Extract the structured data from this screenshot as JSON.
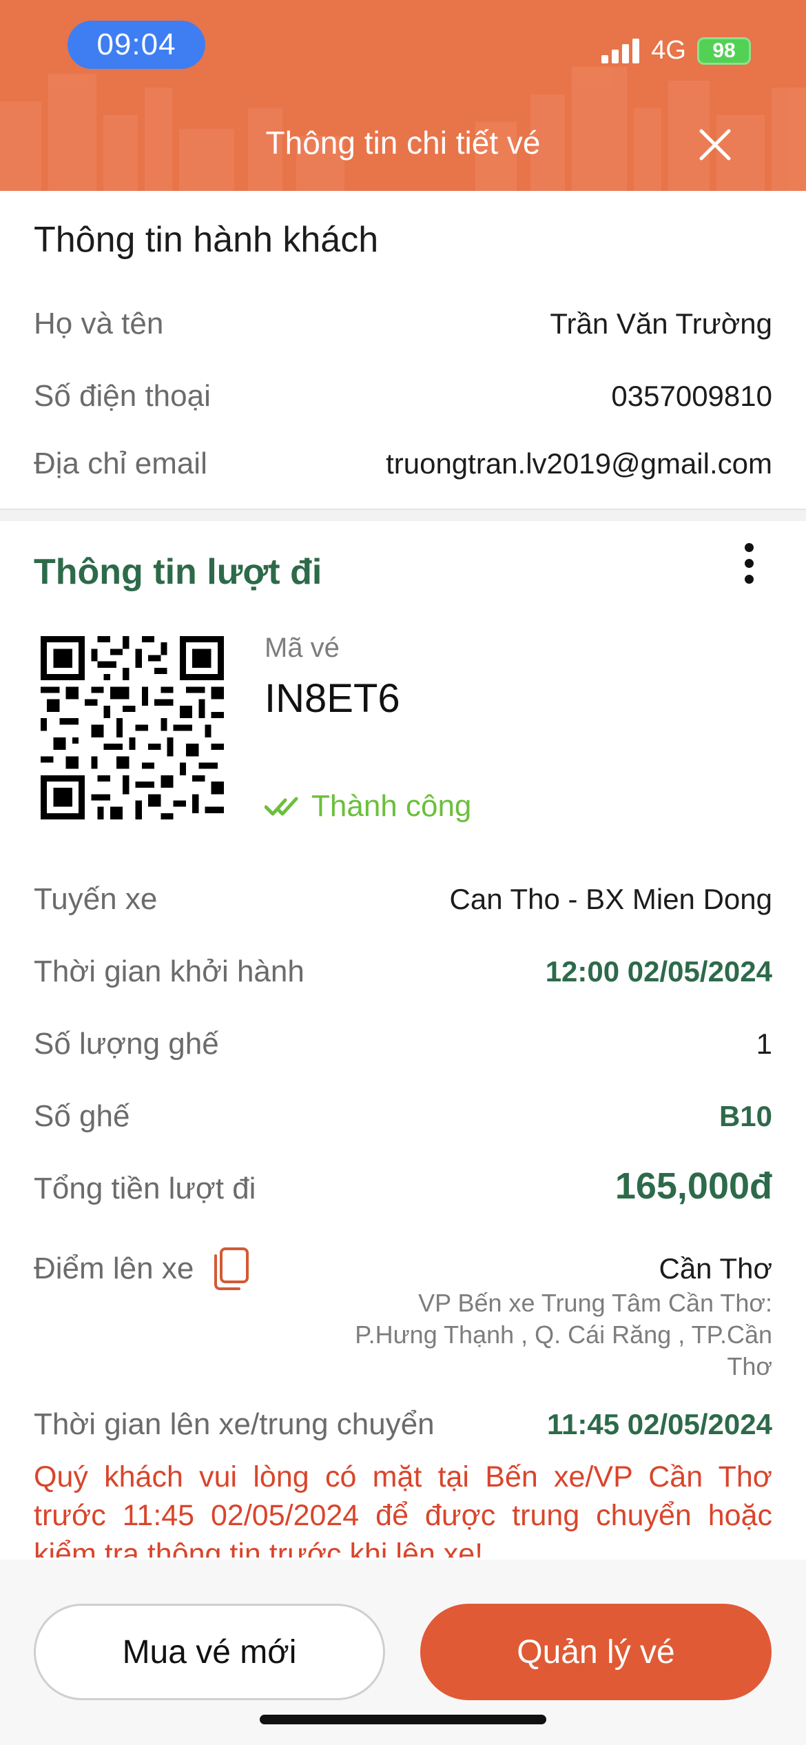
{
  "status_bar": {
    "time": "09:04",
    "network": "4G",
    "battery": "98"
  },
  "header": {
    "title": "Thông tin chi tiết vé"
  },
  "passenger": {
    "title": "Thông tin hành khách",
    "rows": [
      {
        "label": "Họ và tên",
        "value": "Trần Văn Trường"
      },
      {
        "label": "Số điện thoại",
        "value": "0357009810"
      },
      {
        "label": "Địa chỉ email",
        "value": "truongtran.lv2019@gmail.com"
      }
    ]
  },
  "trip": {
    "title": "Thông tin lượt đi",
    "code_label": "Mã vé",
    "code": "IN8ET6",
    "status": "Thành công",
    "route": {
      "label": "Tuyến xe",
      "value": "Can Tho - BX Mien Dong"
    },
    "departure": {
      "label": "Thời gian khởi hành",
      "value": "12:00 02/05/2024"
    },
    "seat_count": {
      "label": "Số lượng ghế",
      "value": "1"
    },
    "seat": {
      "label": "Số ghế",
      "value": "B10"
    },
    "total": {
      "label": "Tổng tiền lượt đi",
      "value": "165,000đ"
    },
    "pickup": {
      "label": "Điểm lên xe",
      "value": "Cần Thơ",
      "address_line1": "VP Bến xe Trung Tâm Cần Thơ:",
      "address_line2": "P.Hưng Thạnh , Q. Cái Răng , TP.Cần",
      "address_line3": "Thơ"
    },
    "boarding_time": {
      "label": "Thời gian lên xe/trung chuyển",
      "value": "11:45 02/05/2024"
    },
    "notice": "Quý khách vui lòng có mặt tại Bến xe/VP Cần Thơ trước 11:45 02/05/2024 để được trung chuyển hoặc kiểm tra thông tin trước khi lên xe!"
  },
  "actions": {
    "buy_new": "Mua vé mới",
    "manage": "Quản lý vé"
  },
  "colors": {
    "brand_orange": "#e05a35",
    "header_orange": "#e8744a",
    "green": "#2d6a4a",
    "success": "#6bbf3c",
    "warning": "#d9452b"
  }
}
